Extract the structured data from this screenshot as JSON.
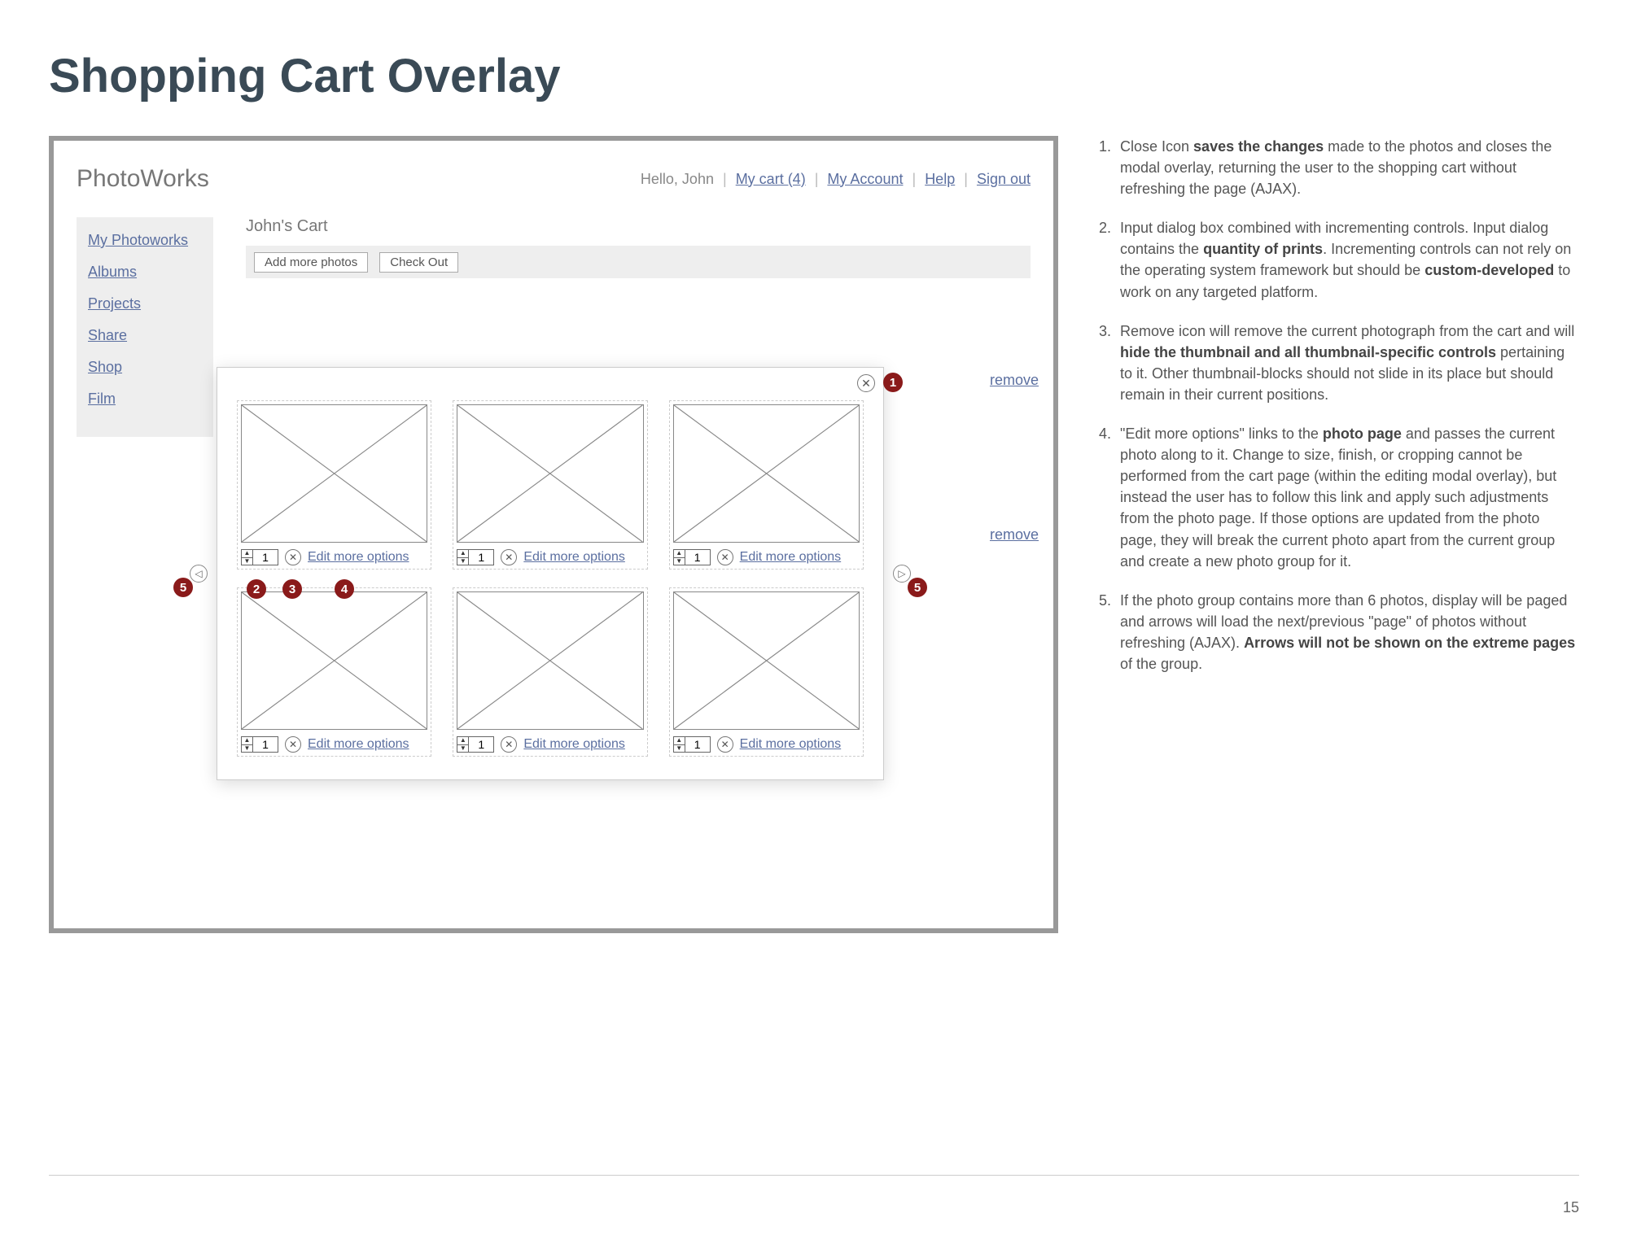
{
  "title": "Shopping Cart Overlay",
  "brand": "PhotoWorks",
  "header": {
    "greeting": "Hello, John",
    "cart": "My cart (4)",
    "account": "My Account",
    "help": "Help",
    "signout": "Sign out"
  },
  "sidebar": {
    "items": [
      "My Photoworks",
      "Albums",
      "Projects",
      "Share",
      "Shop",
      "Film"
    ]
  },
  "main": {
    "cart_title": "John's Cart",
    "add_more": "Add more photos",
    "checkout": "Check Out",
    "remove_label": "remove"
  },
  "modal": {
    "quantity": "1",
    "edit_link": "Edit more options",
    "thumbs": [
      1,
      2,
      3,
      4,
      5,
      6
    ]
  },
  "callouts": [
    "1",
    "2",
    "3",
    "4",
    "5",
    "5"
  ],
  "notes": [
    {
      "pre": "Close Icon ",
      "b": "saves the changes",
      "post": " made to the photos and closes the modal overlay, returning the user to the shopping cart without refreshing the page (AJAX)."
    },
    {
      "pre": "Input dialog box combined with incrementing controls. Input dialog contains the ",
      "b": "quantity of prints",
      "post": ". Incrementing controls can not rely on the operating system framework but should be ",
      "b2": "custom-developed",
      "post2": " to work on any targeted platform."
    },
    {
      "pre": "Remove icon will remove the current photograph from the cart and will ",
      "b": "hide the thumbnail and all thumbnail-specific controls",
      "post": " pertaining to it. Other thumbnail-blocks should not slide in its place but should remain in their current positions."
    },
    {
      "pre": "\"Edit more options\" links to the ",
      "b": "photo page",
      "post": " and passes the current photo along to it. Change to size, finish, or cropping cannot be performed from the cart page (within the editing modal overlay), but instead the user has to follow this link and apply such adjustments from the photo page. If those options are updated from the photo page, they will break the current photo apart from the current group and create a new photo group for it."
    },
    {
      "pre": "If the photo group contains more than 6 photos, display will be paged and arrows will load the next/previous \"page\" of photos without refreshing (AJAX). ",
      "b": "Arrows will not be shown on the extreme pages",
      "post": " of the group."
    }
  ],
  "page_number": "15"
}
